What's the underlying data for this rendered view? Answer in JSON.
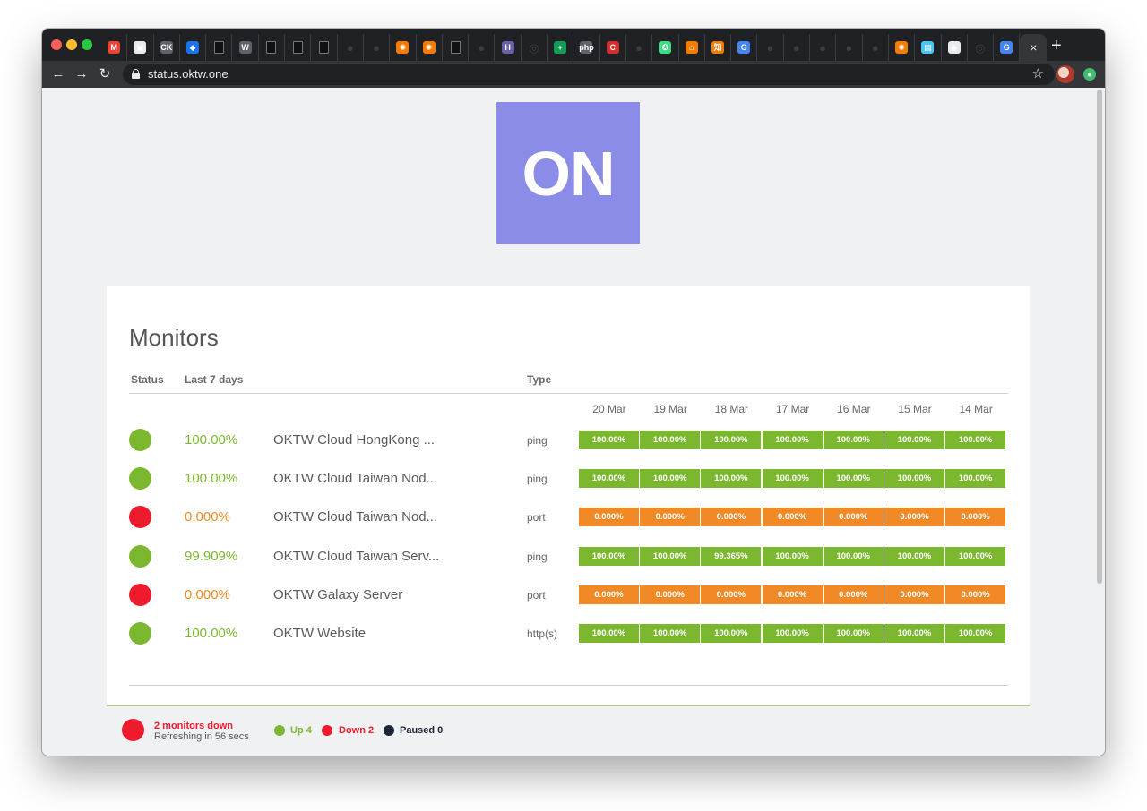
{
  "browser": {
    "url": "status.oktw.one",
    "tabs": [
      {
        "icon": "gmail-icon",
        "glyph": "M",
        "color": "#ea4335"
      },
      {
        "icon": "folder-icon",
        "glyph": "▣",
        "color": "#e8eaed"
      },
      {
        "icon": "chatwork-icon",
        "glyph": "CK",
        "color": "#5f6368"
      },
      {
        "icon": "layers-icon",
        "glyph": "◆",
        "color": "#1a73e8"
      },
      {
        "icon": "document-icon",
        "glyph": "",
        "color": "#000000"
      },
      {
        "icon": "wikipedia-icon",
        "glyph": "W",
        "color": "#5f6368"
      },
      {
        "icon": "document-icon",
        "glyph": "",
        "color": "#000000"
      },
      {
        "icon": "document-icon",
        "glyph": "",
        "color": "#000000"
      },
      {
        "icon": "document-icon",
        "glyph": "",
        "color": "#000000"
      },
      {
        "icon": "github-icon",
        "glyph": "●",
        "color": "#3c3d40"
      },
      {
        "icon": "github-icon",
        "glyph": "●",
        "color": "#3c3d40"
      },
      {
        "icon": "grafana-icon",
        "glyph": "✺",
        "color": "#f57c00"
      },
      {
        "icon": "grafana-icon",
        "glyph": "✺",
        "color": "#f57c00"
      },
      {
        "icon": "document-icon",
        "glyph": "",
        "color": "#000000"
      },
      {
        "icon": "github-icon",
        "glyph": "●",
        "color": "#3c3d40"
      },
      {
        "icon": "heroku-icon",
        "glyph": "H",
        "color": "#6762a6"
      },
      {
        "icon": "globe-icon",
        "glyph": "◎",
        "color": "#3c3d40"
      },
      {
        "icon": "sheets-icon",
        "glyph": "+",
        "color": "#0f9d58"
      },
      {
        "icon": "php-icon",
        "glyph": "php",
        "color": "#5f6368"
      },
      {
        "icon": "ccleaner-icon",
        "glyph": "C",
        "color": "#d32f2f"
      },
      {
        "icon": "github-icon",
        "glyph": "●",
        "color": "#3c3d40"
      },
      {
        "icon": "android-icon",
        "glyph": "✪",
        "color": "#3ddc84"
      },
      {
        "icon": "house-icon",
        "glyph": "⌂",
        "color": "#f57c00"
      },
      {
        "icon": "zhihu-icon",
        "glyph": "知",
        "color": "#f57c00"
      },
      {
        "icon": "google-icon",
        "glyph": "G",
        "color": "#4285f4"
      },
      {
        "icon": "github-icon",
        "glyph": "●",
        "color": "#3c3d40"
      },
      {
        "icon": "github-icon",
        "glyph": "●",
        "color": "#3c3d40"
      },
      {
        "icon": "github-icon",
        "glyph": "●",
        "color": "#3c3d40"
      },
      {
        "icon": "github-icon",
        "glyph": "●",
        "color": "#3c3d40"
      },
      {
        "icon": "github-icon",
        "glyph": "●",
        "color": "#3c3d40"
      },
      {
        "icon": "grafana-icon",
        "glyph": "✺",
        "color": "#f57c00"
      },
      {
        "icon": "jar-icon",
        "glyph": "▤",
        "color": "#4fc3f7"
      },
      {
        "icon": "globe-icon",
        "glyph": "◉",
        "color": "#e8eaed"
      },
      {
        "icon": "globe-icon",
        "glyph": "◎",
        "color": "#3c3d40"
      },
      {
        "icon": "google-icon",
        "glyph": "G",
        "color": "#4285f4"
      }
    ],
    "active_tab_close": "×",
    "new_tab": "+"
  },
  "logo": {
    "text": "ON",
    "color": "#8b8be8"
  },
  "page": {
    "title": "Monitors",
    "headers": {
      "status": "Status",
      "last7": "Last 7 days",
      "type": "Type"
    },
    "dates": [
      "20 Mar",
      "19 Mar",
      "18 Mar",
      "17 Mar",
      "16 Mar",
      "15 Mar",
      "14 Mar"
    ]
  },
  "monitors": [
    {
      "state": "up",
      "uptime": "100.00%",
      "name": "OKTW Cloud HongKong ...",
      "type": "ping",
      "days": [
        "100.00%",
        "100.00%",
        "100.00%",
        "100.00%",
        "100.00%",
        "100.00%",
        "100.00%"
      ]
    },
    {
      "state": "up",
      "uptime": "100.00%",
      "name": "OKTW Cloud Taiwan Nod...",
      "type": "ping",
      "days": [
        "100.00%",
        "100.00%",
        "100.00%",
        "100.00%",
        "100.00%",
        "100.00%",
        "100.00%"
      ]
    },
    {
      "state": "down",
      "uptime": "0.000%",
      "name": "OKTW Cloud Taiwan Nod...",
      "type": "port",
      "days": [
        "0.000%",
        "0.000%",
        "0.000%",
        "0.000%",
        "0.000%",
        "0.000%",
        "0.000%"
      ]
    },
    {
      "state": "up",
      "uptime": "99.909%",
      "name": "OKTW Cloud Taiwan Serv...",
      "type": "ping",
      "days": [
        "100.00%",
        "100.00%",
        "99.365%",
        "100.00%",
        "100.00%",
        "100.00%",
        "100.00%"
      ]
    },
    {
      "state": "down",
      "uptime": "0.000%",
      "name": "OKTW Galaxy Server",
      "type": "port",
      "days": [
        "0.000%",
        "0.000%",
        "0.000%",
        "0.000%",
        "0.000%",
        "0.000%",
        "0.000%"
      ]
    },
    {
      "state": "up",
      "uptime": "100.00%",
      "name": "OKTW Website",
      "type": "http(s)",
      "days": [
        "100.00%",
        "100.00%",
        "100.00%",
        "100.00%",
        "100.00%",
        "100.00%",
        "100.00%"
      ]
    }
  ],
  "footer": {
    "headline": "2 monitors down",
    "refresh": "Refreshing in 56 secs",
    "up": "Up 4",
    "down": "Down 2",
    "paused": "Paused 0"
  },
  "colors": {
    "up": "#7cb82f",
    "down": "#ee1b2e",
    "warning": "#f18a26",
    "paused": "#1b2638"
  }
}
